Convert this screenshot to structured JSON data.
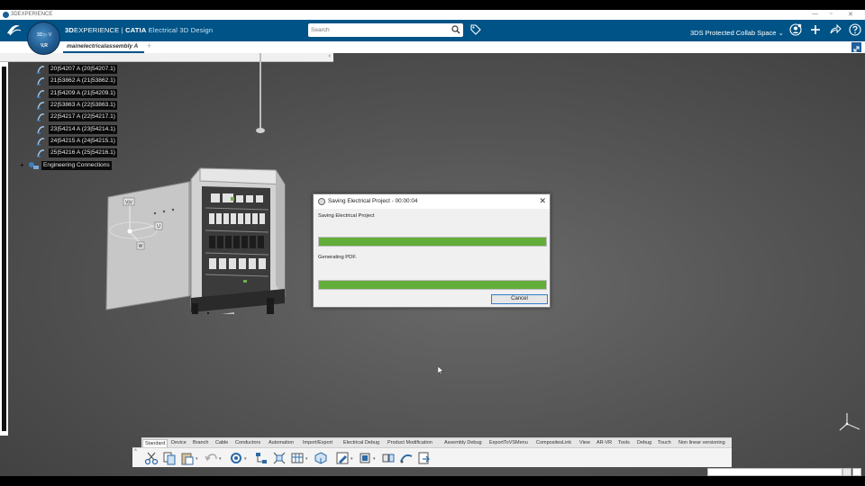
{
  "window": {
    "title": "3DEXPERIENCE",
    "controls": [
      "—",
      "▫",
      "✕"
    ]
  },
  "topbar": {
    "brand_bold": "3D",
    "brand_rest": "EXPERIENCE",
    "brand_sep": " | ",
    "brand_product": "CATIA",
    "brand_app": " Electrical 3D Design",
    "search_placeholder": "Search",
    "collab_space": "3DS Protected Collab Space",
    "collab_arrow": "⌄",
    "accent": "#005386"
  },
  "compass": {
    "top": "3D  ▷  V",
    "bottom": "V,R"
  },
  "tab": {
    "label": "mainelectricalassembly A",
    "add": "+"
  },
  "tree": {
    "items": [
      {
        "label": "20|54207 A (20|54207.1)"
      },
      {
        "label": "21|53862 A (21|53862.1)"
      },
      {
        "label": "21|54209 A (21|54209.1)"
      },
      {
        "label": "22|53863 A (22|53863.1)"
      },
      {
        "label": "22|54217 A (22|54217.1)"
      },
      {
        "label": "23|54214 A (23|54214.1)"
      },
      {
        "label": "24|54215 A (24|54215.1)"
      },
      {
        "label": "25|54216 A (25|54216.1)"
      }
    ],
    "engineering_label": "Engineering Connections",
    "engineering_expand": "+",
    "collapse_chevron": "‹"
  },
  "robot_labels": {
    "top": "V|V",
    "right": "U",
    "bottom": "W"
  },
  "dialog": {
    "title": "Saving Electrical Project - 00:00:04",
    "task1_label": "Saving Electrical Project",
    "task1_progress": 1.0,
    "task2_label": "Generating PDF.",
    "task2_progress": 1.0,
    "cancel_label": "Cancel",
    "close": "✕",
    "progress_color": "#63ae3a"
  },
  "toolbar": {
    "tabs": [
      "Standard",
      "Device",
      "Branch",
      "Cable",
      "Conductors",
      "Automation",
      "Import/Export",
      "Electrical Debug",
      "Product Modification",
      "Assembly Debug",
      "ExportToVSMenu",
      "CompositesLink",
      "View",
      "AR-VR",
      "Tools",
      "Debug",
      "Touch",
      "Non linear versioning"
    ],
    "active_tab": "Standard",
    "collapse": "^",
    "icons": [
      "cut-icon",
      "copy-icon",
      "paste-icon",
      "undo-icon",
      "update-icon",
      "tree-icon",
      "branch-icon",
      "table-icon",
      "part-icon",
      "edit-icon",
      "connector-icon",
      "route-icon",
      "cable-icon",
      "export-icon"
    ]
  }
}
